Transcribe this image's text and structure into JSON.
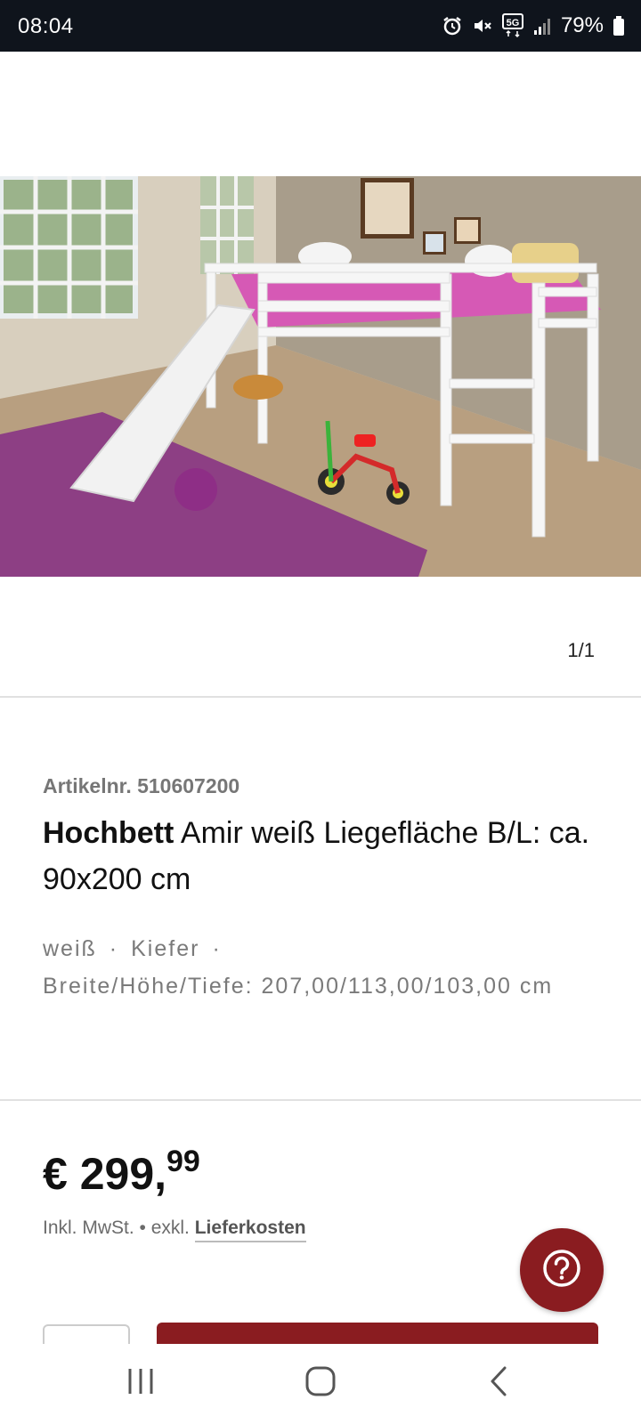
{
  "status_bar": {
    "time": "08:04",
    "network": "5G",
    "battery": "79%",
    "icons": [
      "alarm-icon",
      "mute-icon",
      "5g-icon",
      "signal-icon",
      "battery-icon"
    ]
  },
  "gallery": {
    "counter": "1/1",
    "image_label": "Hochbett mit Rutsche"
  },
  "product": {
    "article_number": "Artikelnr. 510607200",
    "title_bold": "Hochbett",
    "title_rest": " Amir weiß Liegefläche B/L: ca. 90x200 cm",
    "attributes": {
      "color": "weiß",
      "material": "Kiefer",
      "dimensions": "Breite/Höhe/Tiefe: 207,00/113,00/103,00 cm"
    },
    "price": {
      "main": "€ 299,",
      "cents": "99"
    },
    "tax_prefix": "Inkl. MwSt. • exkl.",
    "delivery_link": "Lieferkosten"
  },
  "colors": {
    "brand": "#8a1c20",
    "status_bar": "#0f141c"
  },
  "nav": {
    "icons": [
      "recent-apps-icon",
      "home-icon",
      "back-icon"
    ]
  }
}
